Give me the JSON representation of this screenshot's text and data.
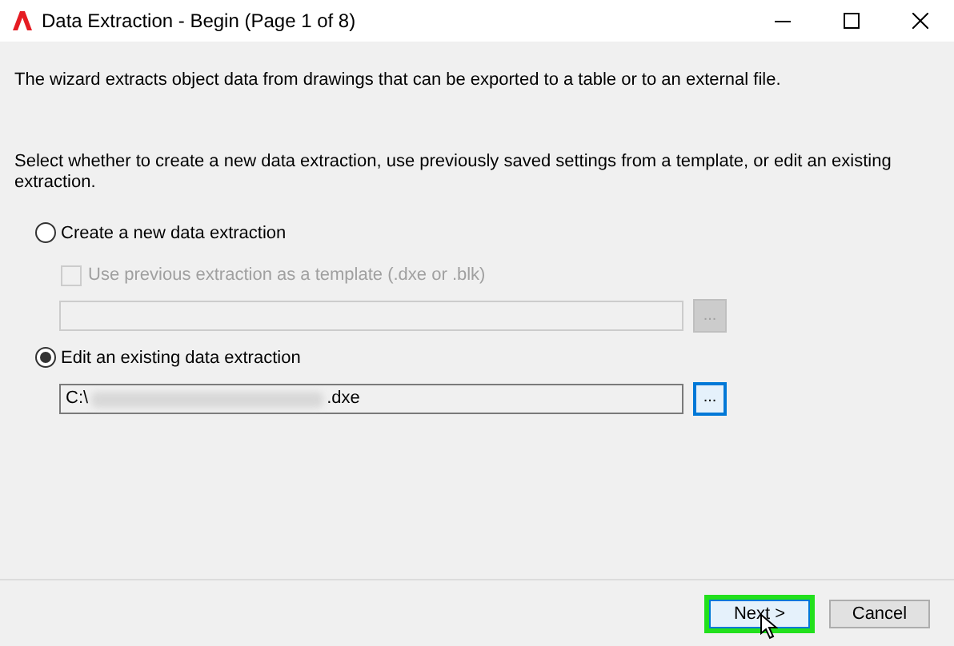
{
  "window": {
    "title": "Data Extraction - Begin (Page 1 of 8)"
  },
  "intro": "The wizard extracts object data from drawings that can be exported to a table or to an external file.",
  "instruction": "Select whether to create a new data extraction, use previously saved settings from a template, or edit an existing extraction.",
  "options": [
    {
      "label": "Create a new data extraction",
      "selected": false,
      "template_checkbox": {
        "label": "Use previous extraction as a template (.dxe or .blk)",
        "checked": false,
        "disabled": true
      },
      "field": {
        "disabled": true
      }
    },
    {
      "label": "Edit an existing data extraction",
      "selected": true,
      "field": {
        "disabled": false,
        "value_start": "C:\\",
        "value_end": ".dxe",
        "focused_browse": true
      }
    }
  ],
  "browse_label": "...",
  "buttons": [
    {
      "label": "Next >",
      "highlighted": true
    },
    {
      "label": "Cancel",
      "highlighted": false
    }
  ]
}
